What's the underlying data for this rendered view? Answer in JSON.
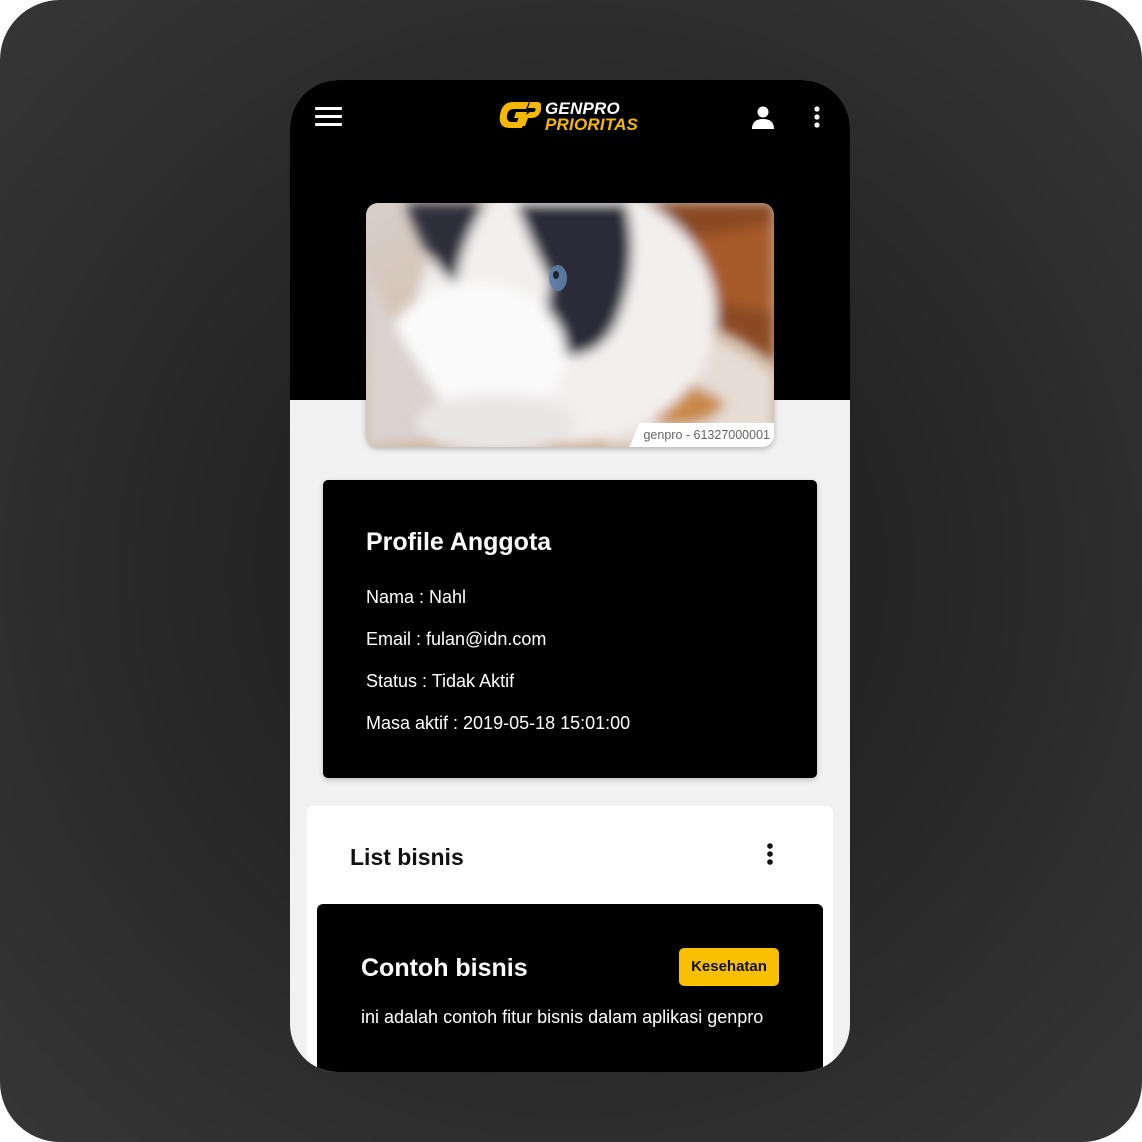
{
  "app": {
    "brand_line1": "GENPRO",
    "brand_line2": "PRIORITAS",
    "brand_color": "#f5b800"
  },
  "toolbar": {
    "menu_icon": "hamburger-menu-icon",
    "account_icon": "person-icon",
    "overflow_icon": "more-vert-icon"
  },
  "member_photo": {
    "caption": "genpro - 61327000001"
  },
  "profile": {
    "title": "Profile Anggota",
    "lines": [
      "Nama : Nahl",
      "Email : fulan@idn.com",
      "Status : Tidak Aktif",
      "Masa aktif : 2019-05-18 15:01:00"
    ]
  },
  "business_list": {
    "title": "List bisnis",
    "items": [
      {
        "name": "Contoh bisnis",
        "category": "Kesehatan",
        "description": "ini adalah contoh fitur bisnis dalam aplikasi genpro"
      }
    ]
  },
  "colors": {
    "header_bg": "#000000",
    "page_bg": "#f1f1f1",
    "badge_bg": "#f8c000"
  }
}
